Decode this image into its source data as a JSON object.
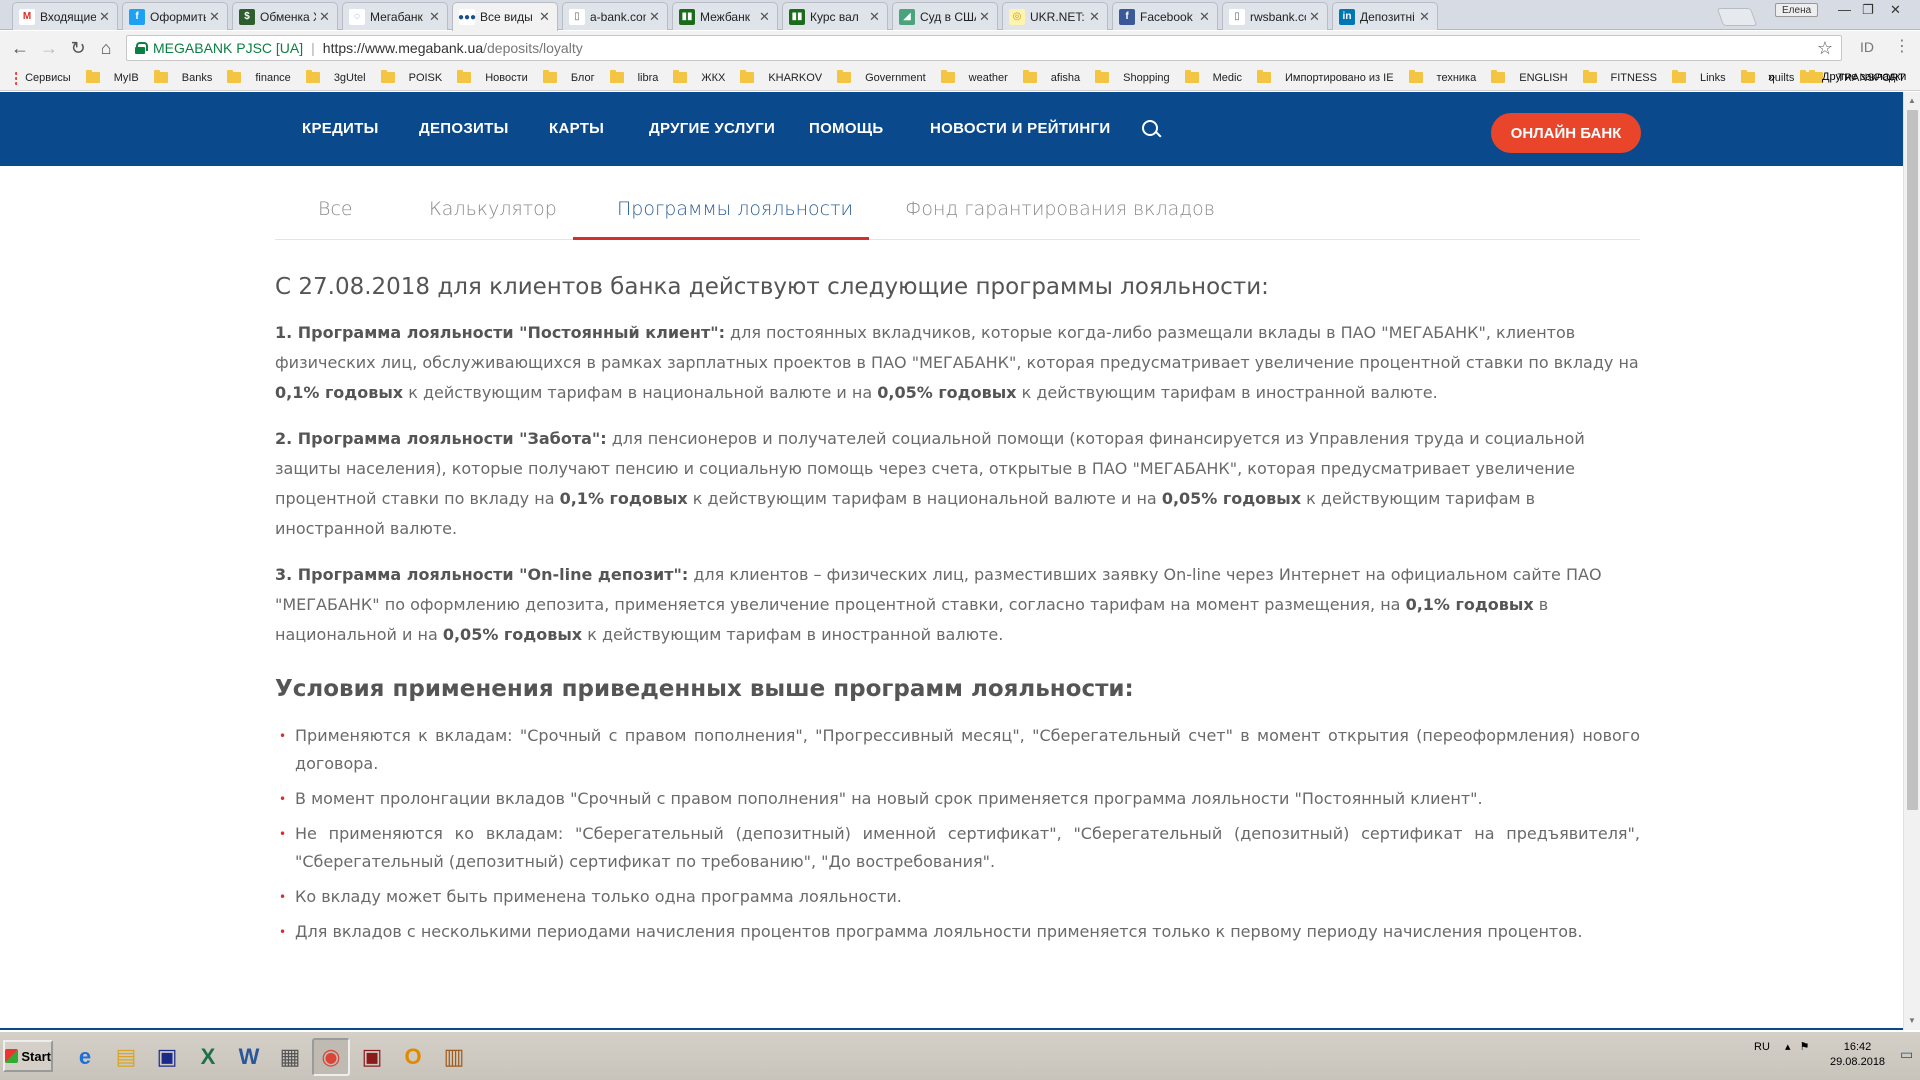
{
  "browser": {
    "tabs": [
      {
        "title": "Входящие - vo",
        "icon": "gmail-icon",
        "color": "#ffffff",
        "glyph": "M",
        "glyph_color": "#d93025"
      },
      {
        "title": "Оформить кре",
        "icon": "finance-icon",
        "color": "#1da1f2",
        "glyph": "f",
        "glyph_color": "#ffffff"
      },
      {
        "title": "Обменка Харь",
        "icon": "exchange-icon",
        "color": "#2e5d2e",
        "glyph": "$",
        "glyph_color": "#ffffff"
      },
      {
        "title": "Мегабанк - Об",
        "icon": "loading-icon",
        "color": "#ffffff",
        "glyph": "◌",
        "glyph_color": "#4285f4"
      },
      {
        "title": "Все виды Депо",
        "icon": "megabank-icon",
        "color": "#ffffff",
        "glyph": "●●●",
        "glyph_color": "#1a4f8c"
      },
      {
        "title": "a-bank.com.ua",
        "icon": "page-icon",
        "color": "#ffffff",
        "glyph": "▯",
        "glyph_color": "#666666"
      },
      {
        "title": "Межбанк",
        "icon": "chart-icon",
        "color": "#1c6b1c",
        "glyph": "▮▮",
        "glyph_color": "#ffffff"
      },
      {
        "title": "Курс вал",
        "icon": "chart-icon",
        "color": "#1c6b1c",
        "glyph": "▮▮",
        "glyph_color": "#ffffff"
      },
      {
        "title": "Суд в США ста",
        "icon": "news-icon",
        "color": "#4aa37a",
        "glyph": "◢",
        "glyph_color": "#ffffff"
      },
      {
        "title": "UKR.NET: Всі н",
        "icon": "ukrnet-icon",
        "color": "#fff3b0",
        "glyph": "◎",
        "glyph_color": "#c79a00"
      },
      {
        "title": "Facebook",
        "icon": "facebook-icon",
        "color": "#3b5998",
        "glyph": "f",
        "glyph_color": "#ffffff"
      },
      {
        "title": "rwsbank.com.u",
        "icon": "page-icon",
        "color": "#ffffff",
        "glyph": "▯",
        "glyph_color": "#666666"
      },
      {
        "title": "Депозитні вкл",
        "icon": "linkedin-icon",
        "color": "#0077b5",
        "glyph": "in",
        "glyph_color": "#ffffff"
      }
    ],
    "active_tab_index": 4,
    "user_badge": "Елена",
    "site_identity": "MEGABANK PJSC [UA]",
    "url_host": "https://www.megabank.ua",
    "url_path": "/deposits/loyalty",
    "bookmarks_apps": "Сервисы",
    "bookmarks": [
      "MyIB",
      "Banks",
      "finance",
      "3gUtel",
      "POISK",
      "Новости",
      "Блог",
      "libra",
      "ЖКХ",
      "KHARKOV",
      "Government",
      "weather",
      "afisha",
      "Shopping",
      "Medic",
      "Импортировано из IE",
      "техника",
      "ENGLISH",
      "FITNESS",
      "Links",
      "quilts",
      "TRANSPORT"
    ],
    "bookmarks_more": "»",
    "bookmarks_other": "Другие закладки"
  },
  "site": {
    "nav": [
      "КРЕДИТЫ",
      "ДЕПОЗИТЫ",
      "КАРТЫ",
      "ДРУГИЕ УСЛУГИ",
      "ПОМОЩЬ",
      "НОВОСТИ И РЕЙТИНГИ"
    ],
    "online_bank": "ОНЛАЙН БАНК",
    "colors": {
      "nav_bg": "#0a4a8c",
      "accent": "#e8452b",
      "active_tab": "#2b5e95",
      "underline": "#d32f2f"
    }
  },
  "subtabs": [
    "Все",
    "Калькулятор",
    "Программы лояльности",
    "Фонд гарантирования вкладов"
  ],
  "active_subtab": 2,
  "article": {
    "heading": "С 27.08.2018 для клиентов банка действуют следующие программы лояльности:",
    "programs": [
      {
        "title": "1. Программа лояльности \"Постоянный клиент\":",
        "t1": " для постоянных вкладчиков, которые когда-либо размещали вклады в ПАО \"МЕГАБАНК\", клиентов физических лиц, обслуживающихся в рамках зарплатных проектов в ПАО \"МЕГАБАНК\", которая предусматривает увеличение процентной ставки по вкладу на ",
        "b1": "0,1% годовых",
        "t2": " к действующим тарифам в национальной валюте и на ",
        "b2": "0,05% годовых",
        "t3": " к действующим тарифам в иностранной валюте."
      },
      {
        "title": "2. Программа лояльности \"Забота\":",
        "t1": " для пенсионеров и получателей социальной помощи (которая финансируется из Управления труда и социальной защиты населения), которые получают пенсию и социальную помощь через счета, открытые в ПАО \"МЕГАБАНК\", которая предусматривает увеличение процентной ставки по вкладу на ",
        "b1": "0,1% годовых",
        "t2": " к действующим тарифам в национальной валюте и на ",
        "b2": "0,05% годовых",
        "t3": " к действующим тарифам в иностранной валюте."
      },
      {
        "title": "3. Программа лояльности \"On-line депозит\":",
        "t1": " для клиентов – физических лиц, разместивших заявку On-line через Интернет на официальном сайте ПАО \"МЕГАБАНК\" по оформлению депозита, применяется увеличение процентной ставки, согласно тарифам на момент размещения, на ",
        "b1": "0,1% годовых",
        "t2": " в национальной и на ",
        "b2": "0,05% годовых",
        "t3": " к действующим тарифам в иностранной валюте."
      }
    ],
    "conditions_heading": "Условия применения приведенных выше программ лояльности:",
    "conditions": [
      "Применяются к вкладам: \"Срочный с правом пополнения\", \"Прогрессивный месяц\", \"Сберегательный счет\" в момент открытия (переоформления) нового договора.",
      "В момент пролонгации вкладов \"Срочный с правом пополнения\" на новый срок применяется программа лояльности \"Постоянный клиент\".",
      "Не применяются ко вкладам: \"Сберегательный (депозитный) именной сертификат\", \"Сберегательный (депозитный) сертификат на предъявителя\", \"Сберегательный (депозитный) сертификат по требованию\", \"До востребования\".",
      "Ко вкладу может быть применена только одна программа лояльности.",
      "Для вкладов с несколькими периодами начисления процентов программа лояльности применяется только к первому периоду начисления процентов."
    ]
  },
  "taskbar": {
    "start_label": "Start",
    "apps": [
      {
        "name": "ie-icon",
        "glyph": "e",
        "color": "#1e6fd9"
      },
      {
        "name": "explorer-icon",
        "glyph": "▤",
        "color": "#d9a520"
      },
      {
        "name": "save-disk-icon",
        "glyph": "▣",
        "color": "#1b2a8a"
      },
      {
        "name": "excel-icon",
        "glyph": "X",
        "color": "#1e7145"
      },
      {
        "name": "word-icon",
        "glyph": "W",
        "color": "#2b579a"
      },
      {
        "name": "calculator-icon",
        "glyph": "▦",
        "color": "#555555"
      },
      {
        "name": "chrome-icon",
        "glyph": "◉",
        "color": "#db4437"
      },
      {
        "name": "save-disk-icon",
        "glyph": "▣",
        "color": "#8a1b1b"
      },
      {
        "name": "outlook-icon",
        "glyph": "O",
        "color": "#e08a00"
      },
      {
        "name": "archive-icon",
        "glyph": "▥",
        "color": "#a05a1a"
      }
    ],
    "active_app_index": 6,
    "language": "RU",
    "time": "16:42",
    "date": "29.08.2018"
  }
}
